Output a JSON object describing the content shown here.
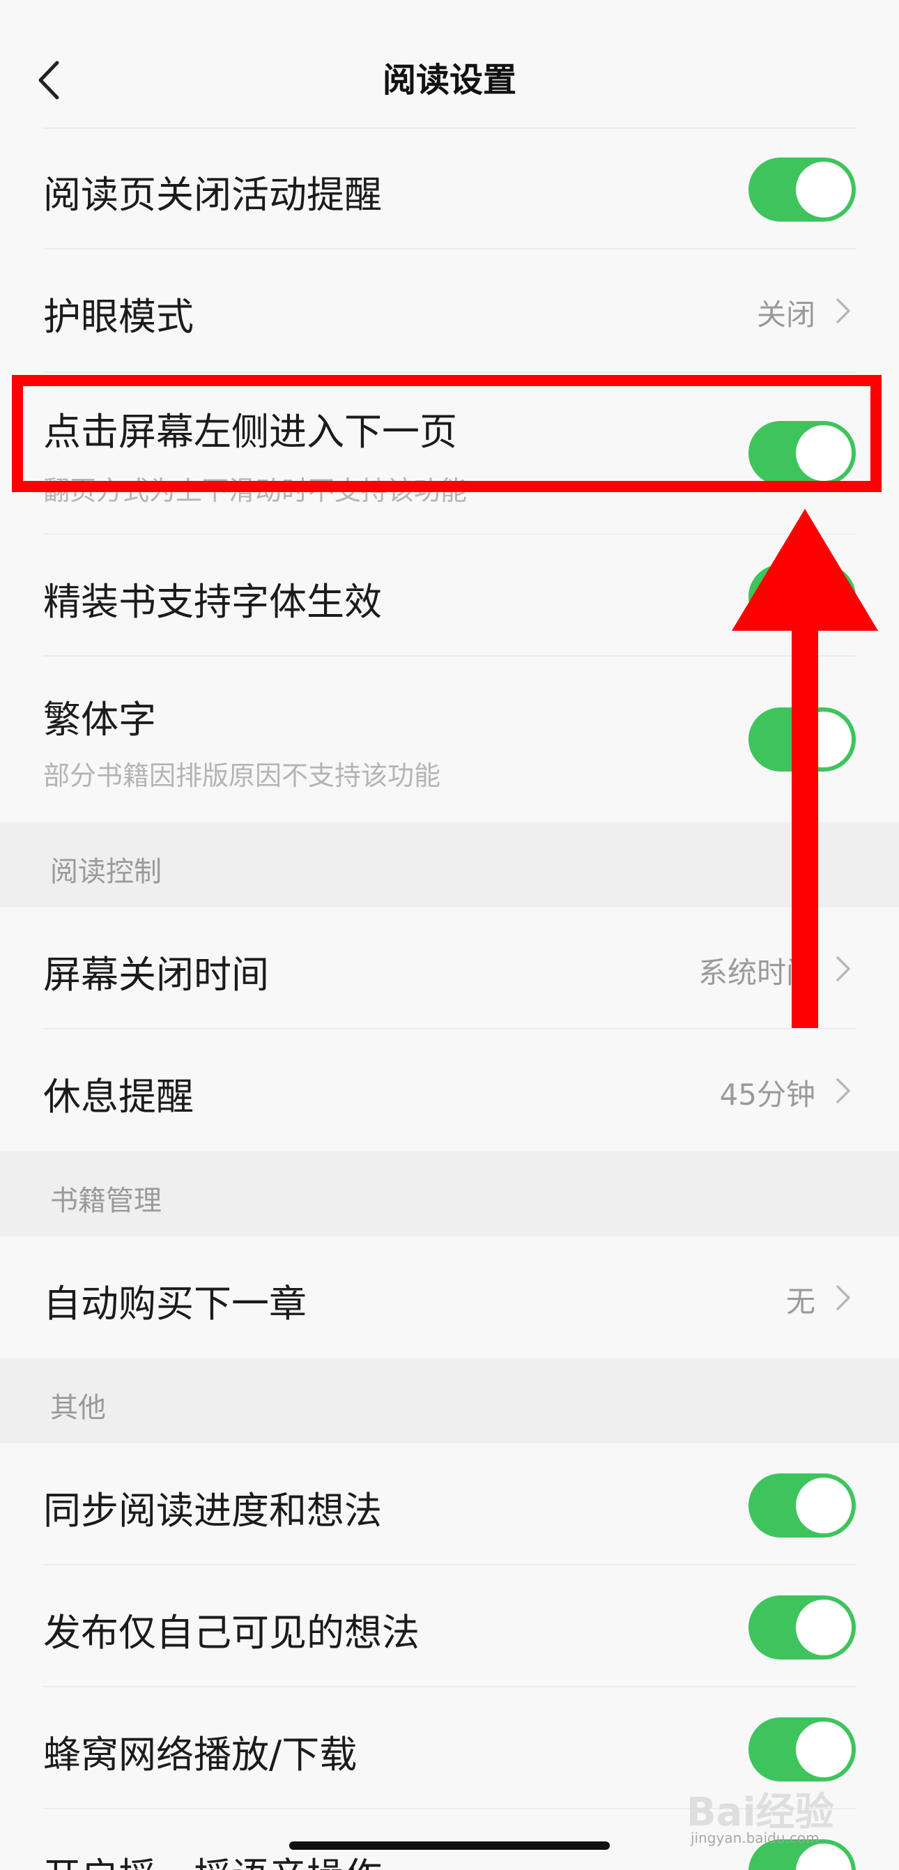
{
  "header": {
    "title": "阅读设置"
  },
  "rows": {
    "close_activity": {
      "label": "阅读页关闭活动提醒",
      "on": true
    },
    "eye_mode": {
      "label": "护眼模式",
      "value": "关闭"
    },
    "tap_left": {
      "label": "点击屏幕左侧进入下一页",
      "sub": "翻页方式为上下滑动时不支持该功能",
      "on": true
    },
    "fine_font": {
      "label": "精装书支持字体生效",
      "on": true
    },
    "traditional": {
      "label": "繁体字",
      "sub": "部分书籍因排版原因不支持该功能",
      "on": true
    },
    "screen_off": {
      "label": "屏幕关闭时间",
      "value": "系统时间"
    },
    "rest_reminder": {
      "label": "休息提醒",
      "value": "45分钟"
    },
    "auto_buy": {
      "label": "自动购买下一章",
      "value": "无"
    },
    "sync_progress": {
      "label": "同步阅读进度和想法",
      "on": true
    },
    "private_thoughts": {
      "label": "发布仅自己可见的想法",
      "on": true
    },
    "cellular": {
      "label": "蜂窝网络播放/下载",
      "on": true
    },
    "shake_voice": {
      "label": "开启摇一摇语音操作",
      "on": true
    }
  },
  "sections": {
    "reading_control": "阅读控制",
    "book_management": "书籍管理",
    "other": "其他"
  },
  "watermark": {
    "main": "Bai经验",
    "sub": "jingyan.baidu.com"
  },
  "colors": {
    "toggle_on": "#3ec45c",
    "annotation": "#ff0000"
  }
}
